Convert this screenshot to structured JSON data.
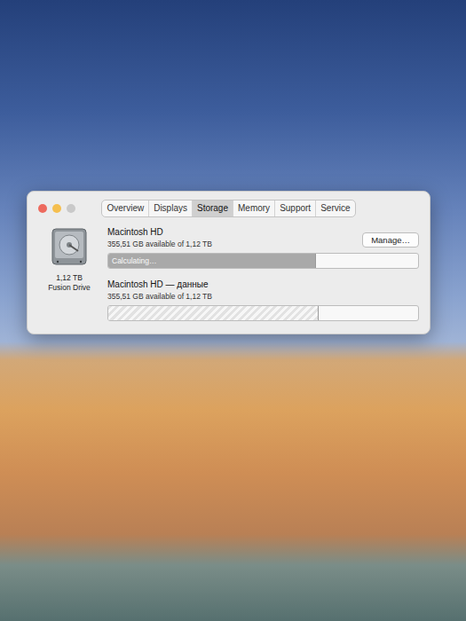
{
  "window": {
    "controls": [
      {
        "kind": "close",
        "color": "#ed6a5e"
      },
      {
        "kind": "minimize",
        "color": "#f5bf4f"
      },
      {
        "kind": "zoom",
        "color": "#c9c9c9"
      }
    ]
  },
  "tabs": [
    {
      "label": "Overview",
      "selected": false
    },
    {
      "label": "Displays",
      "selected": false
    },
    {
      "label": "Storage",
      "selected": true
    },
    {
      "label": "Memory",
      "selected": false
    },
    {
      "label": "Support",
      "selected": false
    },
    {
      "label": "Service",
      "selected": false
    }
  ],
  "disk": {
    "size": "1,12 TB",
    "type": "Fusion Drive"
  },
  "volumes": [
    {
      "name": "Macintosh HD",
      "info": "355,51 GB available of 1,12 TB",
      "kind": "calculating",
      "level": 0.67,
      "bar_label": "Calculating…",
      "button": "Manage…"
    },
    {
      "name": "Macintosh HD — данные",
      "info": "355,51 GB available of 1,12 TB",
      "kind": "hatched",
      "level": 0.68
    }
  ]
}
